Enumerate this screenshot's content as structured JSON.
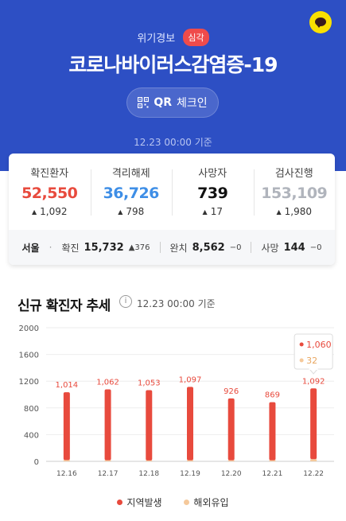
{
  "alert": {
    "label": "위기경보",
    "level": "심각"
  },
  "title": "코로나바이러스감염증-19",
  "qr_button": {
    "strong": "QR",
    "text": "체크인"
  },
  "timestamp": "12.23 00:00 기준",
  "stats": [
    {
      "label": "확진환자",
      "value": "52,550",
      "change": "1,092",
      "color": "#e84a3d"
    },
    {
      "label": "격리해제",
      "value": "36,726",
      "change": "798",
      "color": "#3e8ee6"
    },
    {
      "label": "사망자",
      "value": "739",
      "change": "17",
      "color": "#111111"
    },
    {
      "label": "검사진행",
      "value": "153,109",
      "change": "1,980",
      "color": "#b0b4bc"
    }
  ],
  "regional": {
    "region": "서울",
    "confirmed_label": "확진",
    "confirmed": "15,732",
    "confirmed_change": "376",
    "released_label": "완치",
    "released": "8,562",
    "released_change": "0",
    "deaths_label": "사망",
    "deaths": "144",
    "deaths_change": "0"
  },
  "trend": {
    "title": "신규 확진자 추세",
    "timestamp": "12.23 00:00 기준"
  },
  "chart_data": {
    "type": "bar",
    "categories": [
      "12.16",
      "12.17",
      "12.18",
      "12.19",
      "12.20",
      "12.21",
      "12.22"
    ],
    "series": [
      {
        "name": "지역발생",
        "values": [
          1014,
          1062,
          1053,
          1097,
          926,
          869,
          1060
        ],
        "color": "#e84a3d"
      },
      {
        "name": "해외유입",
        "values": [
          20,
          16,
          13,
          17,
          16,
          17,
          32
        ],
        "color": "#f5c99b"
      }
    ],
    "totals": [
      1014,
      1062,
      1053,
      1097,
      926,
      869,
      1092
    ],
    "y_ticks": [
      0,
      400,
      800,
      1200,
      1600,
      2000
    ],
    "ylim": [
      0,
      2000
    ],
    "tooltip": {
      "category_index": 6,
      "local": "1,060",
      "overseas": "32"
    }
  }
}
